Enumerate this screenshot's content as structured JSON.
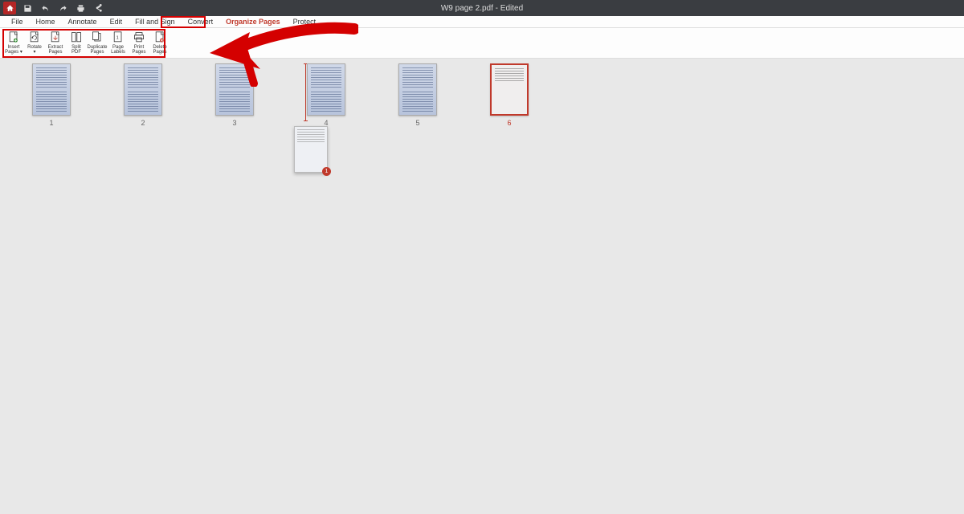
{
  "titlebar": {
    "title": "W9 page 2.pdf - Edited"
  },
  "menubar": {
    "items": [
      {
        "label": "File"
      },
      {
        "label": "Home"
      },
      {
        "label": "Annotate"
      },
      {
        "label": "Edit"
      },
      {
        "label": "Fill and Sign"
      },
      {
        "label": "Convert"
      },
      {
        "label": "Organize Pages",
        "active": true
      },
      {
        "label": "Protect"
      }
    ]
  },
  "toolbar": {
    "buttons": [
      {
        "label": "Insert\nPages ▾",
        "icon": "insert"
      },
      {
        "label": "Rotate\n▾",
        "icon": "rotate"
      },
      {
        "label": "Extract\nPages",
        "icon": "extract"
      },
      {
        "label": "Split\nPDF",
        "icon": "split"
      },
      {
        "label": "Duplicate\nPages",
        "icon": "duplicate"
      },
      {
        "label": "Page\nLabels",
        "icon": "labels"
      },
      {
        "label": "Print\nPages",
        "icon": "print"
      },
      {
        "label": "Delete\nPages",
        "icon": "delete"
      }
    ]
  },
  "thumbs": {
    "pages": [
      {
        "num": "1"
      },
      {
        "num": "2"
      },
      {
        "num": "3"
      },
      {
        "num": "4"
      },
      {
        "num": "5"
      },
      {
        "num": "6",
        "selected": true
      }
    ],
    "drag_badge": "1"
  },
  "colors": {
    "accent": "#c0392b",
    "titlebar": "#3a3d41"
  }
}
